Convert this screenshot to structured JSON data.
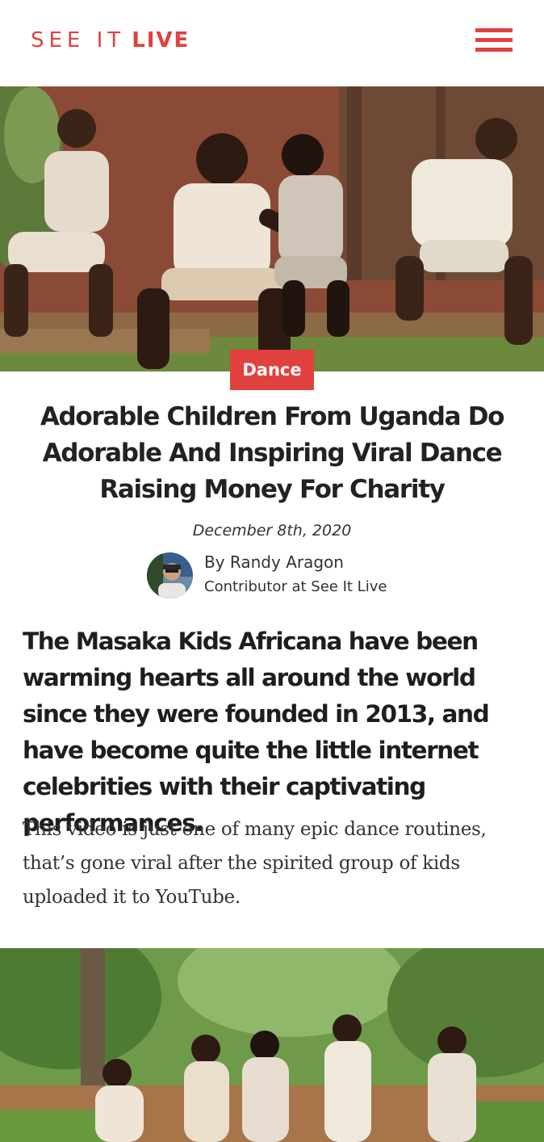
{
  "header": {
    "logo_light": "SEE IT",
    "logo_bold": "LIVE",
    "menu_icon": "hamburger-menu-icon",
    "brand_color": "#e0413f"
  },
  "hero": {
    "image_description": "children dancing outdoors"
  },
  "article": {
    "category": "Dance",
    "title": "Adorable Children From Uganda Do Adorable And Inspiring Viral Dance Raising Money For Charity",
    "date": "December 8th, 2020",
    "author": {
      "name": "By Randy Aragon",
      "role": "Contributor at See It Live"
    },
    "lead": "The Masaka Kids Africana have been warming hearts all around the world since they were founded in 2013, and have become quite the little internet celebrities with their captivating performances.",
    "body": "This video is just one of many epic dance routines, that’s gone viral after the spirited group of kids uploaded it to YouTube."
  }
}
